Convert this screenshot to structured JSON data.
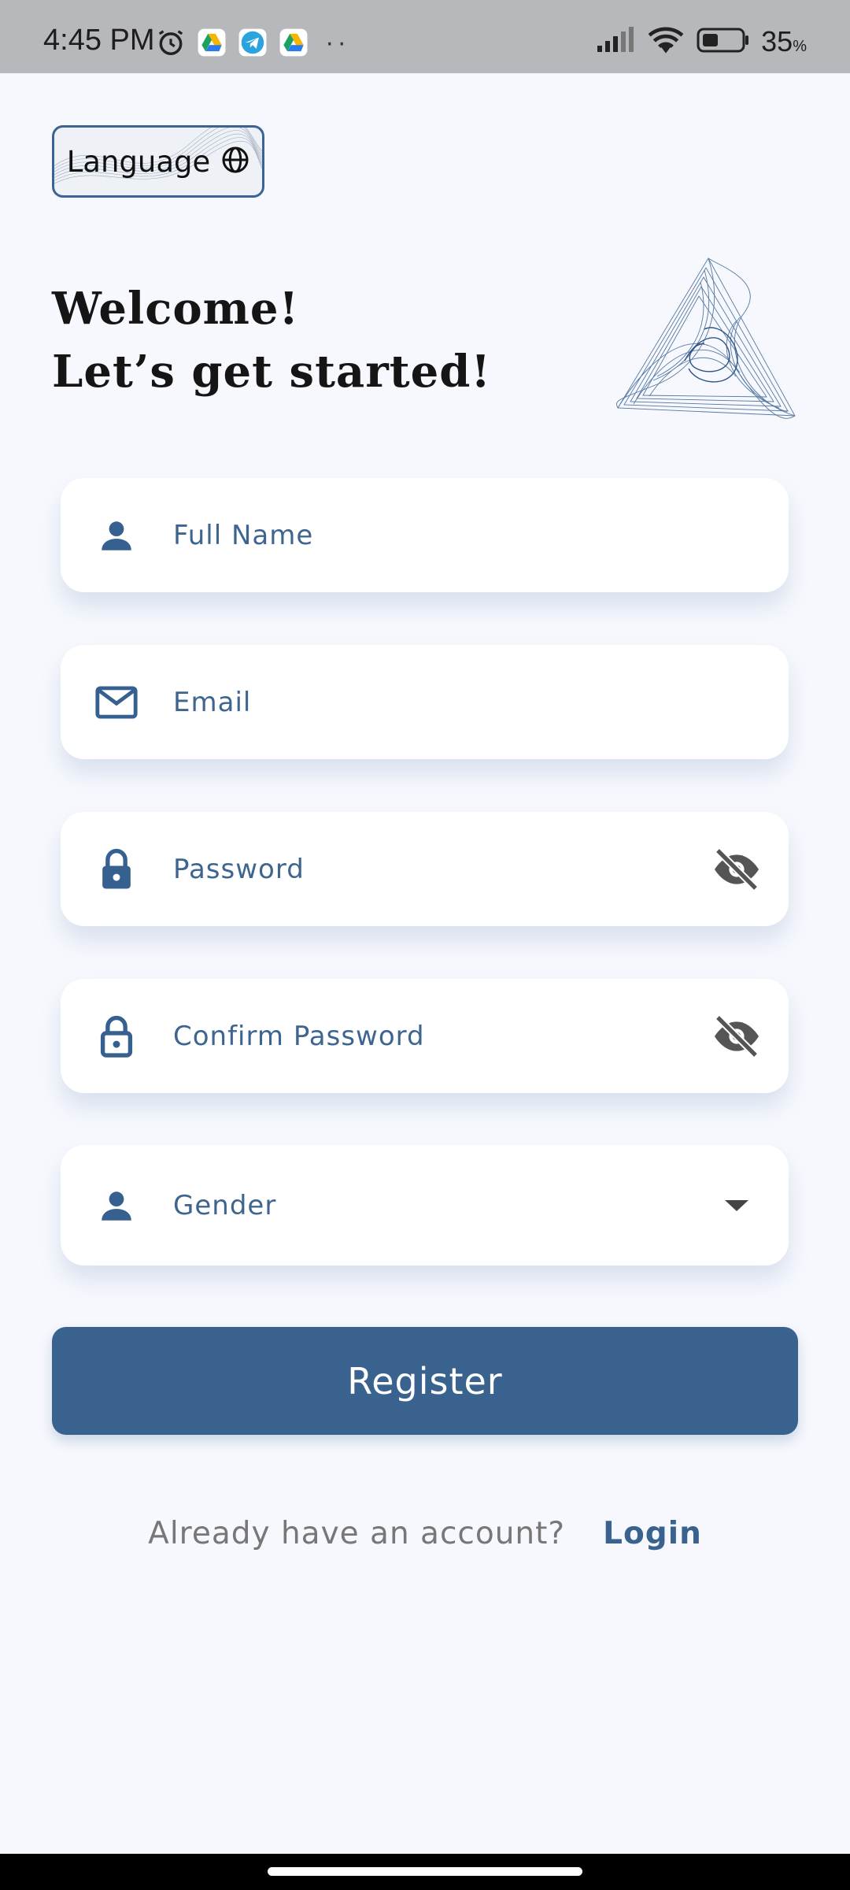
{
  "status_bar": {
    "time": "4:45 PM",
    "battery": "35",
    "battery_unit": "%",
    "dots": "··",
    "icons": [
      "alarm-icon",
      "drive-icon",
      "telegram-icon",
      "drive-icon",
      "signal-icon",
      "wifi-icon",
      "battery-icon"
    ]
  },
  "language_button": {
    "label": "Language",
    "icon": "globe-icon"
  },
  "welcome": {
    "line1": "Welcome!",
    "line2": "Let’s get started!"
  },
  "form": {
    "full_name": {
      "placeholder": "Full Name",
      "icon": "person-icon"
    },
    "email": {
      "placeholder": "Email",
      "icon": "mail-icon"
    },
    "password": {
      "placeholder": "Password",
      "icon": "lock-icon",
      "trailing_icon": "visibility-off-icon"
    },
    "confirm_password": {
      "placeholder": "Confirm Password",
      "icon": "lock-outline-icon",
      "trailing_icon": "visibility-off-icon"
    },
    "gender": {
      "label": "Gender",
      "icon": "person-icon",
      "trailing_icon": "dropdown-arrow-icon"
    }
  },
  "register_button": {
    "label": "Register"
  },
  "login_prompt": {
    "question": "Already have an account?",
    "link": "Login"
  },
  "colors": {
    "primary": "#39628f",
    "background": "#f6f8fd",
    "status_bar": "#b7b8bc",
    "field_bg": "#ffffff",
    "muted_text": "#777777"
  }
}
